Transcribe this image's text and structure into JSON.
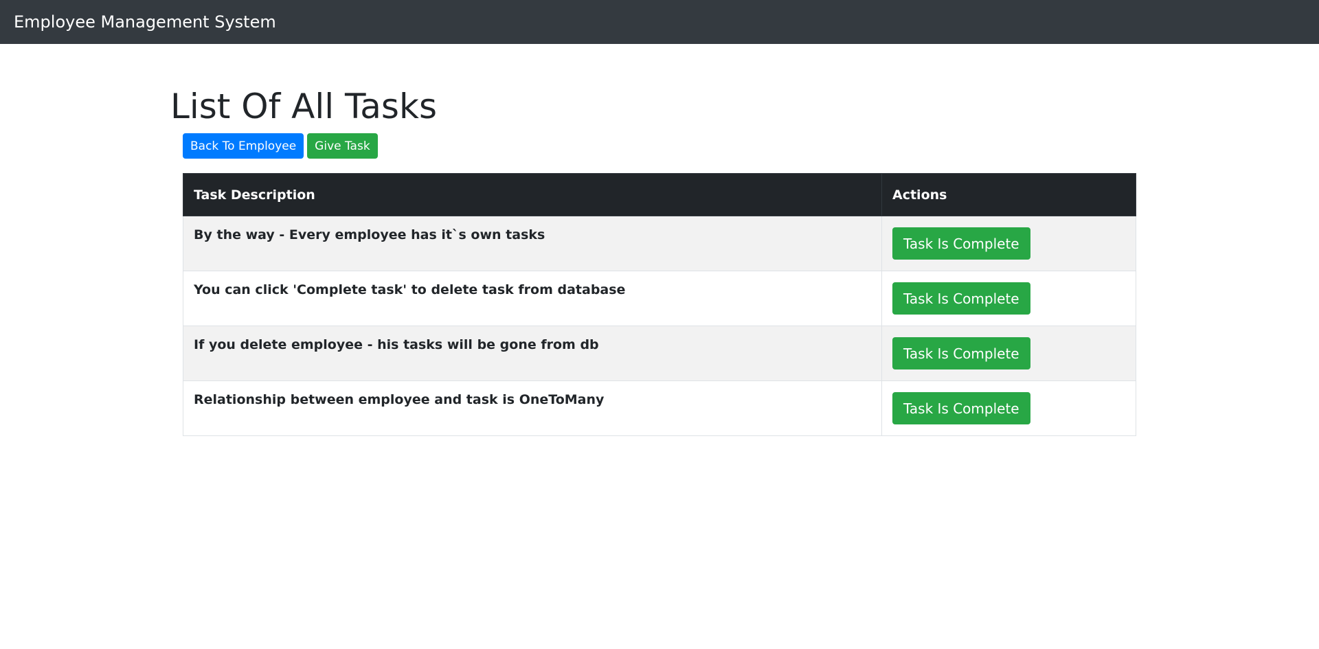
{
  "navbar": {
    "brand": "Employee Management System"
  },
  "page": {
    "title": "List Of All Tasks",
    "back_button_label": "Back To Employee",
    "give_task_button_label": "Give Task"
  },
  "table": {
    "headers": [
      "Task Description",
      "Actions"
    ],
    "rows": [
      {
        "description": "By the way - Every employee has it`s own tasks",
        "action_label": "Task Is Complete"
      },
      {
        "description": "You can click 'Complete task' to delete task from database",
        "action_label": "Task Is Complete"
      },
      {
        "description": "If you delete employee - his tasks will be gone from db",
        "action_label": "Task Is Complete"
      },
      {
        "description": "Relationship between employee and task is OneToMany",
        "action_label": "Task Is Complete"
      }
    ]
  },
  "colors": {
    "navbar_bg": "#343a40",
    "primary": "#007bff",
    "success": "#28a745",
    "table_header_bg": "#212529",
    "stripe": "#f2f2f2"
  }
}
